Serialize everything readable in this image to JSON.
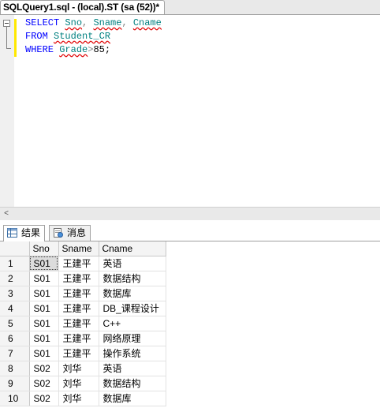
{
  "document_tab": {
    "title": "SQLQuery1.sql - (local).ST (sa (52))*"
  },
  "editor": {
    "line1": {
      "keyword": "SELECT",
      "c1": "Sno",
      "sep1": ",",
      "c2": "Sname",
      "sep2": ",",
      "c3": "Cname"
    },
    "line2": {
      "keyword": "FROM",
      "table": "Student_CR"
    },
    "line3": {
      "keyword": "WHERE",
      "column": "Grade",
      "operator": ">",
      "value": "85;"
    }
  },
  "scrollbar": {
    "left_arrow": "<"
  },
  "results_tabs": [
    {
      "label": "结果",
      "icon": "grid-icon",
      "active": true
    },
    {
      "label": "消息",
      "icon": "messages-icon",
      "active": false
    }
  ],
  "grid": {
    "columns": [
      "Sno",
      "Sname",
      "Cname"
    ],
    "rows": [
      {
        "num": "1",
        "sno": "S01",
        "sname": "王建平",
        "cname": "英语"
      },
      {
        "num": "2",
        "sno": "S01",
        "sname": "王建平",
        "cname": "数据结构"
      },
      {
        "num": "3",
        "sno": "S01",
        "sname": "王建平",
        "cname": "数据库"
      },
      {
        "num": "4",
        "sno": "S01",
        "sname": "王建平",
        "cname": "DB_课程设计"
      },
      {
        "num": "5",
        "sno": "S01",
        "sname": "王建平",
        "cname": "C++"
      },
      {
        "num": "6",
        "sno": "S01",
        "sname": "王建平",
        "cname": "网络原理"
      },
      {
        "num": "7",
        "sno": "S01",
        "sname": "王建平",
        "cname": "操作系统"
      },
      {
        "num": "8",
        "sno": "S02",
        "sname": "刘华",
        "cname": "英语"
      },
      {
        "num": "9",
        "sno": "S02",
        "sname": "刘华",
        "cname": "数据结构"
      },
      {
        "num": "10",
        "sno": "S02",
        "sname": "刘华",
        "cname": "数据库"
      }
    ]
  },
  "colors": {
    "keyword": "#0000ff",
    "identifier": "#008080",
    "change_bar": "#ffe800"
  }
}
